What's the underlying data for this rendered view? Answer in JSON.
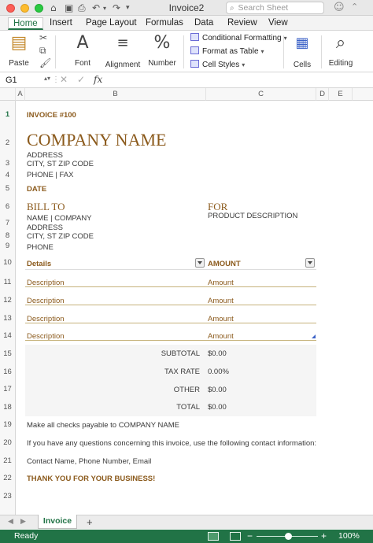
{
  "window": {
    "title": "Invoice2",
    "search_placeholder": "Search Sheet"
  },
  "tabs": [
    "Home",
    "Insert",
    "Page Layout",
    "Formulas",
    "Data",
    "Review",
    "View"
  ],
  "ribbon": {
    "paste": "Paste",
    "font": "Font",
    "alignment": "Alignment",
    "number": "Number",
    "conditional_formatting": "Conditional Formatting",
    "format_as_table": "Format as Table",
    "cell_styles": "Cell Styles",
    "cells": "Cells",
    "editing": "Editing"
  },
  "formula_bar": {
    "name_box": "G1",
    "fx": "fx",
    "content": ""
  },
  "columns": [
    "A",
    "B",
    "C",
    "D",
    "E"
  ],
  "rows": [
    "1",
    "2",
    "3",
    "4",
    "5",
    "6",
    "7",
    "8",
    "9",
    "10",
    "11",
    "12",
    "13",
    "14",
    "15",
    "16",
    "17",
    "18",
    "19",
    "20",
    "21",
    "22",
    "23"
  ],
  "invoice": {
    "number": "INVOICE #100",
    "company_name": "COMPANY NAME",
    "address": "ADDRESS",
    "city": "CITY, ST ZIP CODE",
    "phone_fax": "PHONE | FAX",
    "date": "DATE",
    "bill_to": "BILL TO",
    "for": "FOR",
    "product_description": "PRODUCT DESCRIPTION",
    "name_company": "NAME | COMPANY",
    "bill_address": "ADDRESS",
    "bill_city": "CITY, ST ZIP CODE",
    "bill_phone": "PHONE",
    "details_header": "Details",
    "amount_header": "AMOUNT",
    "line_items": [
      {
        "description": "Description",
        "amount": "Amount"
      },
      {
        "description": "Description",
        "amount": "Amount"
      },
      {
        "description": "Description",
        "amount": "Amount"
      },
      {
        "description": "Description",
        "amount": "Amount"
      }
    ],
    "totals": [
      {
        "label": "SUBTOTAL",
        "value": "$0.00"
      },
      {
        "label": "TAX RATE",
        "value": "0.00%"
      },
      {
        "label": "OTHER",
        "value": "$0.00"
      },
      {
        "label": "TOTAL",
        "value": "$0.00"
      }
    ],
    "note_checks": "Make all checks payable to COMPANY NAME",
    "note_questions": "If you have any questions concerning this invoice, use the following contact information:",
    "note_contact": "Contact Name, Phone Number, Email",
    "thanks": "THANK YOU FOR YOUR BUSINESS!"
  },
  "sheet_tab": "Invoice",
  "status": {
    "text": "Ready",
    "zoom": "100%"
  },
  "colors": {
    "accent_green": "#217346",
    "invoice_gold": "#8b5a1c"
  }
}
